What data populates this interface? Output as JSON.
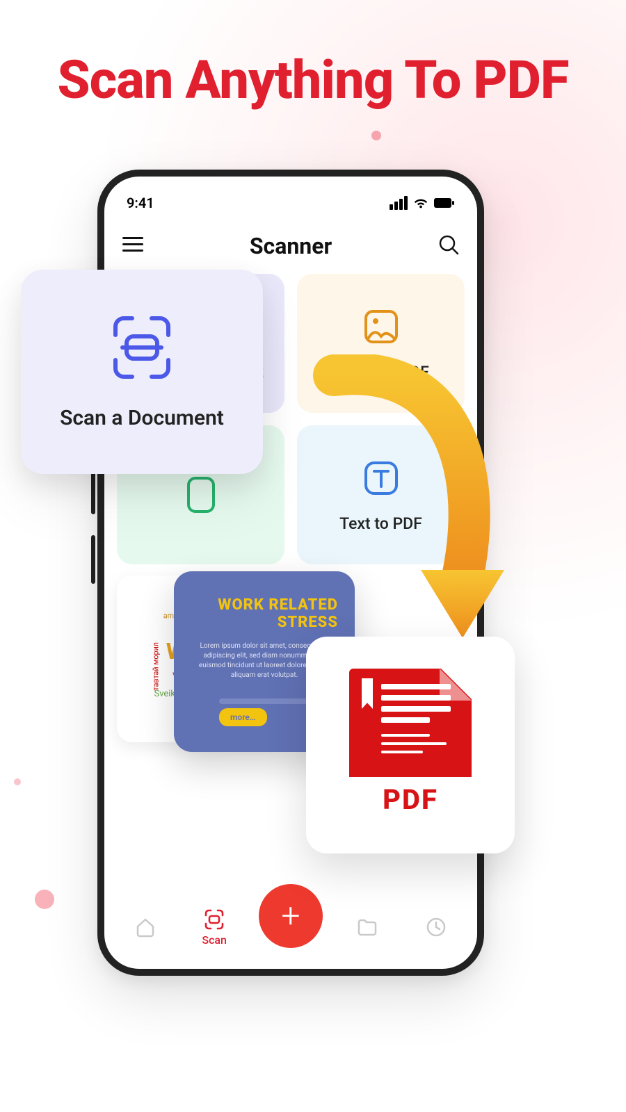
{
  "promo": {
    "headline": "Scan Anything To PDF"
  },
  "statusbar": {
    "time": "9:41"
  },
  "header": {
    "title": "Scanner"
  },
  "cards": {
    "scan": {
      "label": "Scan a Document"
    },
    "image": {
      "label": "Image to PDF"
    },
    "text": {
      "label": "Text to PDF"
    }
  },
  "pop": {
    "scan_label": "Scan a Document"
  },
  "float_stress": {
    "title_line1": "WORK RELATED",
    "title_line2": "STRESS",
    "body": "Lorem ipsum dolor sit amet, consectetuer adipiscing elit, sed diam nonummy nibh euismod tincidunt ut laoreet dolore magna aliquam erat volutpat.",
    "more": "more…"
  },
  "pdf": {
    "label": "PDF"
  },
  "bottom_nav": {
    "scan_label": "Scan"
  }
}
